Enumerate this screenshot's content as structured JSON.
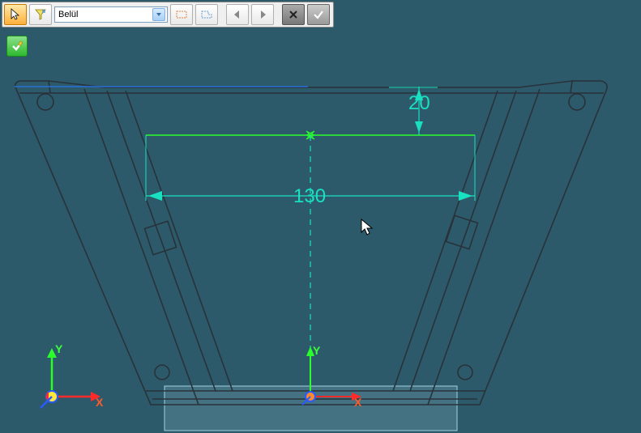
{
  "toolbar": {
    "filter_dropdown": {
      "value": "Belül"
    }
  },
  "dimensions": {
    "width": "130",
    "height": "20"
  },
  "axes": {
    "x": "X",
    "y": "Y",
    "x2": "X",
    "y2": "Y"
  }
}
